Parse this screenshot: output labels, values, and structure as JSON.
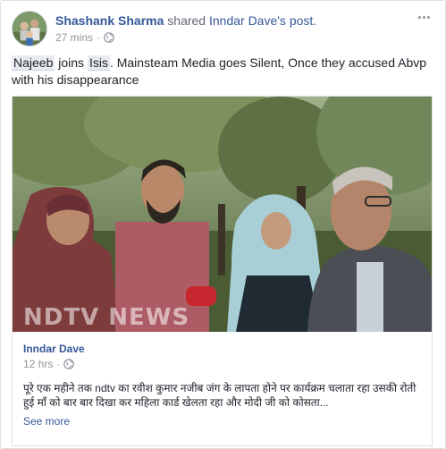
{
  "post": {
    "author": "Shashank Sharma",
    "action": "shared",
    "target": "Inndar Dave's post.",
    "time": "27 mins",
    "separator": "·",
    "privacy_icon": "globe-icon",
    "more_icon": "more-options-icon",
    "text": {
      "tag1": "Najeeb",
      "word_joins": "joins",
      "tag2": "Isis",
      "rest": ". Mainsteam Media goes Silent, Once they accused Abvp with his disappearance"
    }
  },
  "shared_post": {
    "image_watermark": "NDTV NEWS",
    "author": "Inndar Dave",
    "time": "12 hrs",
    "separator": "·",
    "privacy_icon": "globe-icon",
    "text": "पूरे एक महीने तक ndtv का रवीश कुमार नजीब जंग के लापता होने पर कार्यक्रम चलाता रहा उसकी रोती हुई माँ को बार बार दिखा कर महिला कार्ड खेलता रहा और मोदी जी को कोसता...",
    "see_more": "See more"
  },
  "colors": {
    "link": "#365899",
    "text": "#1d2129",
    "meta": "#90949c",
    "border": "#dddfe2"
  }
}
